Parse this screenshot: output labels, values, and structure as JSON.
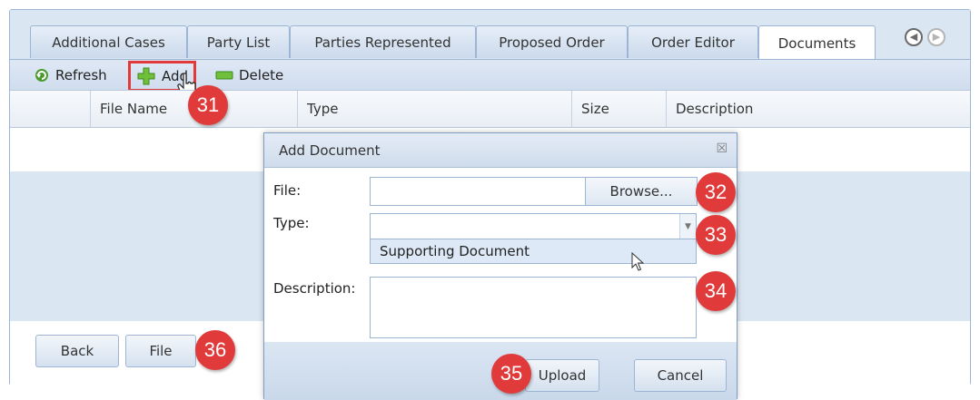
{
  "tabs": [
    {
      "label": "Additional Cases"
    },
    {
      "label": "Party List"
    },
    {
      "label": "Parties Represented"
    },
    {
      "label": "Proposed Order"
    },
    {
      "label": "Order Editor"
    },
    {
      "label": "Documents"
    }
  ],
  "active_tab": "Documents",
  "nav": {
    "prev_icon": "chevron-left-circle-icon",
    "next_icon": "chevron-right-circle-icon"
  },
  "toolbar": {
    "refresh_label": "Refresh",
    "add_label": "Add",
    "delete_label": "Delete"
  },
  "grid": {
    "columns": [
      "File Name",
      "Type",
      "Size",
      "Description"
    ]
  },
  "footer": {
    "back_label": "Back",
    "file_label": "File"
  },
  "dialog": {
    "title": "Add Document",
    "file_label": "File:",
    "file_value": "",
    "browse_label": "Browse...",
    "type_label": "Type:",
    "type_value": "",
    "type_options": [
      "Supporting Document"
    ],
    "description_label": "Description:",
    "description_value": "",
    "upload_label": "Upload",
    "cancel_label": "Cancel"
  },
  "callouts": [
    "31",
    "32",
    "33",
    "34",
    "35",
    "36"
  ],
  "colors": {
    "callout": "#e03a3a",
    "highlight": "#e03a3a",
    "frame": "#dbe6f3"
  }
}
